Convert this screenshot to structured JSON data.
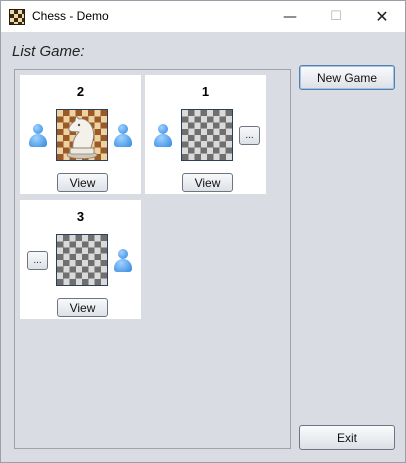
{
  "window": {
    "title": "Chess - Demo",
    "minimize_glyph": "—",
    "maximize_glyph": "☐",
    "close_glyph": "✕"
  },
  "list_label": "List Game:",
  "games": [
    {
      "number": "2",
      "board_style": "wood-with-knight",
      "view_label": "View",
      "left_player": "user-icon",
      "right_player": "user-icon"
    },
    {
      "number": "1",
      "board_style": "grey",
      "view_label": "View",
      "left_player": "user-icon",
      "right_button_label": "..."
    },
    {
      "number": "3",
      "board_style": "grey",
      "view_label": "View",
      "left_button_label": "...",
      "right_player": "user-icon"
    }
  ],
  "buttons": {
    "new_game": "New Game",
    "exit": "Exit"
  },
  "colors": {
    "window_bg": "#d9dde3",
    "player_icon": "#2f86e0"
  }
}
